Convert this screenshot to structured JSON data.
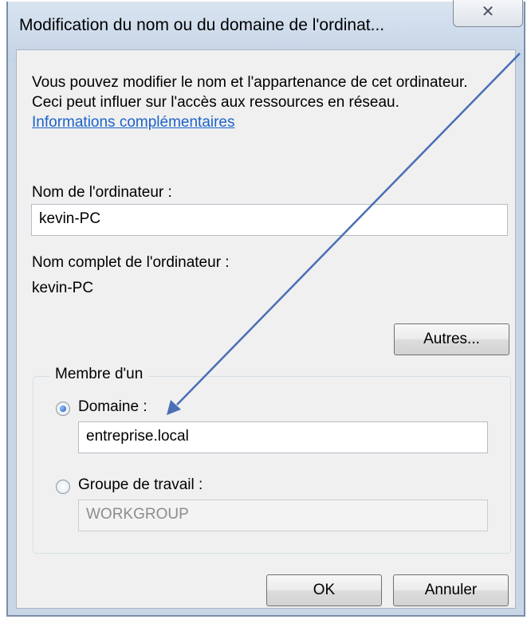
{
  "window": {
    "title": "Modification du nom ou du domaine de l'ordinat...",
    "close_icon": "close-icon"
  },
  "description": {
    "text": "Vous pouvez modifier le nom et l'appartenance de cet ordinateur. Ceci peut influer sur l'accès aux ressources en réseau. ",
    "link": "Informations complémentaires"
  },
  "computer_name": {
    "label": "Nom de l'ordinateur :",
    "value": "kevin-PC"
  },
  "full_name": {
    "label": "Nom complet de l'ordinateur :",
    "value": "kevin-PC"
  },
  "buttons": {
    "more": "Autres...",
    "ok": "OK",
    "cancel": "Annuler"
  },
  "member_of": {
    "label": "Membre d'un",
    "domain_label": "Domaine :",
    "domain_value": "entreprise.local",
    "domain_selected": true,
    "workgroup_label": "Groupe de travail :",
    "workgroup_value": "WORKGROUP",
    "workgroup_selected": false
  },
  "colors": {
    "annotation_arrow": "#4a6fb5",
    "link": "#1c63c9"
  }
}
